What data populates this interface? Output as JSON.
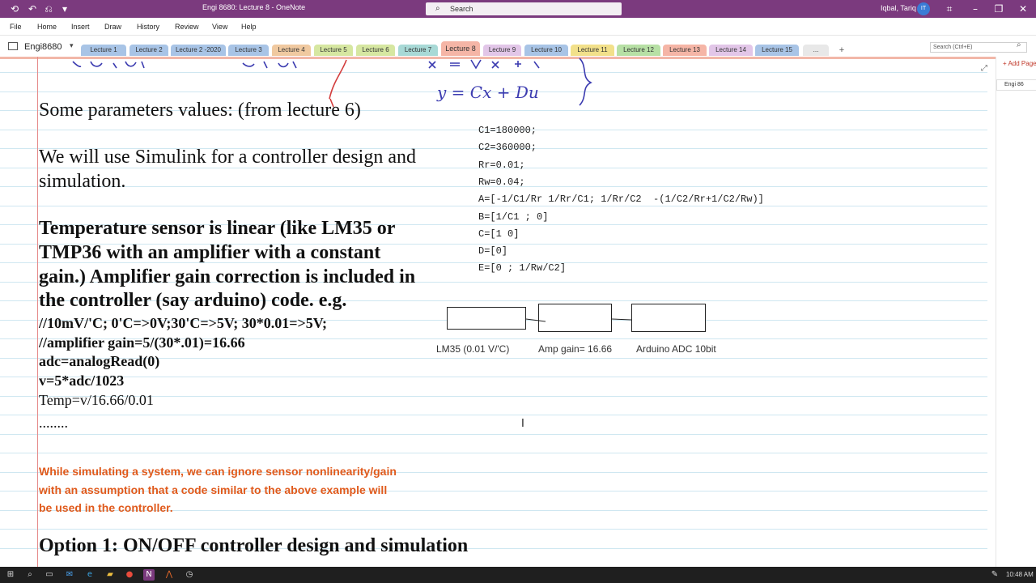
{
  "window": {
    "title": "Engi 8680: Lecture 8 - OneNote",
    "search_placeholder": "Search",
    "user_name": "Iqbal, Tariq",
    "user_initials": "IT"
  },
  "menu": [
    "File",
    "Home",
    "Insert",
    "Draw",
    "History",
    "Review",
    "View",
    "Help"
  ],
  "notebook": {
    "name": "Engi8680",
    "sections": [
      {
        "label": "Lecture 1",
        "color": "#a8c4e6"
      },
      {
        "label": "Lecture 2",
        "color": "#a8c4e6"
      },
      {
        "label": "Lecture 2 -2020",
        "color": "#a8c4e6"
      },
      {
        "label": "Lecture 3",
        "color": "#a8c4e6"
      },
      {
        "label": "Lecture 4",
        "color": "#f0c9a0"
      },
      {
        "label": "Lecture 5",
        "color": "#d6e7a1"
      },
      {
        "label": "Lecture 6",
        "color": "#d6e7a1"
      },
      {
        "label": "Lecture 7",
        "color": "#a8d9d6"
      },
      {
        "label": "Lecture 8",
        "color": "#f5b5a6"
      },
      {
        "label": "Lecture 9",
        "color": "#e2c6e8"
      },
      {
        "label": "Lecture 10",
        "color": "#a8c4e6"
      },
      {
        "label": "Lecture 11",
        "color": "#f2e08a"
      },
      {
        "label": "Lecture 12",
        "color": "#b7e0a5"
      },
      {
        "label": "Lecture 13",
        "color": "#f5b5a6"
      },
      {
        "label": "Lecture 14",
        "color": "#e2c6e8"
      },
      {
        "label": "Lecture 15",
        "color": "#a8c4e6"
      }
    ],
    "more_label": "...",
    "page_search_placeholder": "Search (Ctrl+E)"
  },
  "page_pane": {
    "add_page_label": "Add Page",
    "pages": [
      "Engi 86"
    ]
  },
  "note": {
    "handwriting_top_left": "standard state space form",
    "handwriting_top_right": "x = Ax + Bu",
    "handwriting_eq": "y = Cx + Du",
    "params_heading": "Some parameters values: (from lecture 6)",
    "simulink_line1": "We will use Simulink for a controller design and",
    "simulink_line2": "simulation.",
    "sensor_lines": [
      "Temperature sensor is linear (like LM35 or",
      "TMP36 with an amplifier with a constant",
      "gain.) Amplifier gain correction is included in",
      "the controller (say arduino) code. e.g."
    ],
    "code_comment1": "//10mV/'C; 0'C=>0V;30'C=>5V; 30*0.01=>5V;",
    "code_comment2": "//amplifier gain=5/(30*.01)=16.66",
    "code_read": "adc=analogRead(0)",
    "code_v": "v=5*adc/1023",
    "code_temp": "Temp=v/16.66/0.01",
    "ellipsis": "........",
    "note_lines": [
      "While simulating a system, we can ignore sensor nonlinearity/gain",
      "with an assumption that a code similar to the above example will",
      "be used in the controller."
    ],
    "option_heading": "Option 1:  ON/OFF controller design and simulation",
    "matlab_code": [
      "C1=180000;",
      "C2=360000;",
      "Rr=0.01;",
      "Rw=0.04;",
      "A=[-1/C1/Rr 1/Rr/C1; 1/Rr/C2  -(1/C2/Rr+1/C2/Rw)]",
      "B=[1/C1 ; 0]",
      "C=[1 0]",
      "D=[0]",
      "E=[0 ; 1/Rw/C2]"
    ],
    "block_labels": [
      "LM35 (0.01 V/'C)",
      "Amp gain= 16.66",
      "Arduino ADC 10bit"
    ]
  },
  "taskbar": {
    "clock": "10:48 AM"
  }
}
